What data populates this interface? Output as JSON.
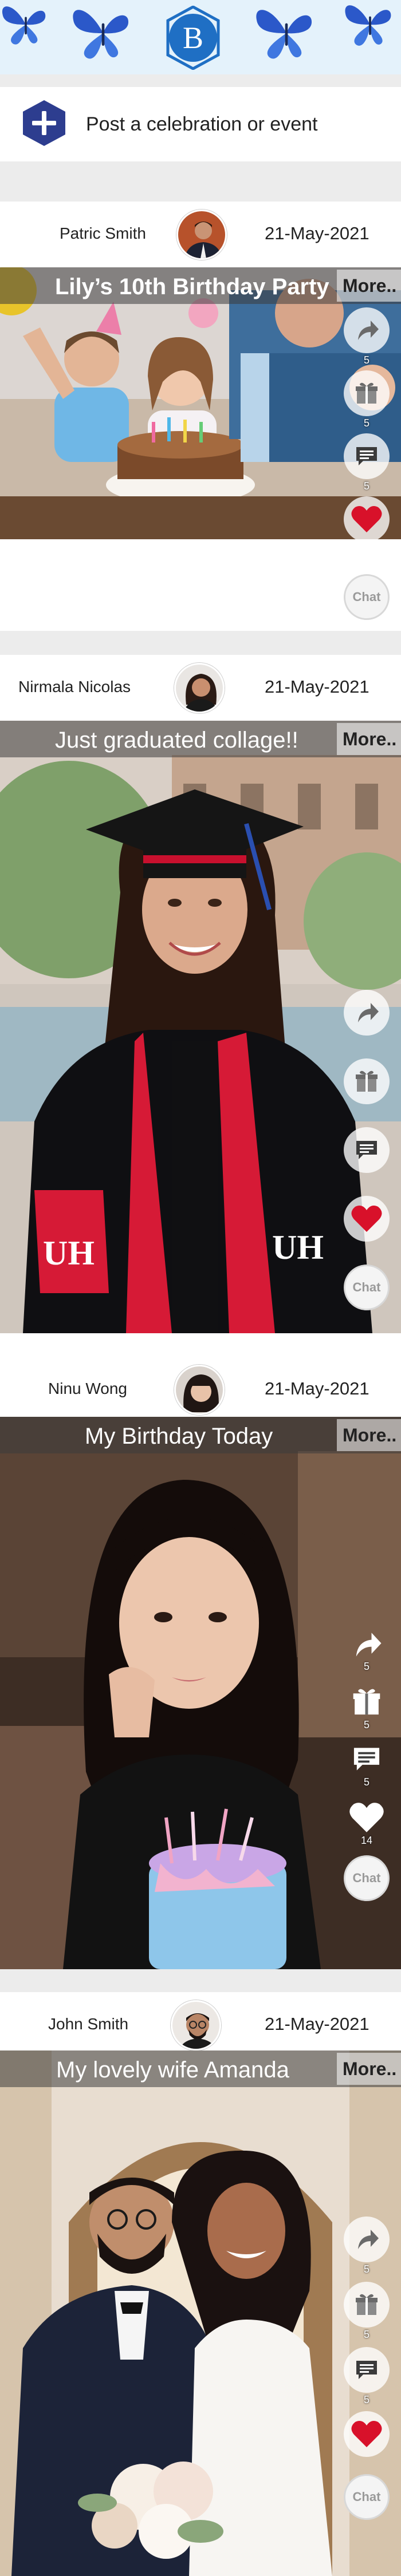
{
  "app": {
    "logo_letter": "B",
    "brand_color": "#1f6fc4",
    "header_bg": "#e4f2fb",
    "butterfly_color": "#2b58c9"
  },
  "composer": {
    "prompt": "Post a celebration or event",
    "icon": "plus-icon"
  },
  "posts": [
    {
      "author": "Patric Smith",
      "date": "21-May-2021",
      "caption": "Lily’s 10th Birthday Party",
      "more_label": "More..",
      "share_count": "5",
      "gift_count": "5",
      "comment_count": "5",
      "like_count": "",
      "chat_label": "Chat",
      "like_active": true
    },
    {
      "author": "Nirmala Nicolas",
      "date": "21-May-2021",
      "caption": "Just graduated collage!!",
      "more_label": "More..",
      "share_count": "",
      "gift_count": "",
      "comment_count": "",
      "like_count": "",
      "chat_label": "Chat",
      "like_active": true
    },
    {
      "author": "Ninu Wong",
      "date": "21-May-2021",
      "caption": "My Birthday Today",
      "more_label": "More..",
      "share_count": "5",
      "gift_count": "5",
      "comment_count": "5",
      "like_count": "14",
      "chat_label": "Chat",
      "like_active": false
    },
    {
      "author": "John Smith",
      "date": "21-May-2021",
      "caption": "My lovely wife Amanda",
      "more_label": "More..",
      "share_count": "5",
      "gift_count": "5",
      "comment_count": "5",
      "like_count": "",
      "chat_label": "Chat",
      "like_active": true
    }
  ]
}
